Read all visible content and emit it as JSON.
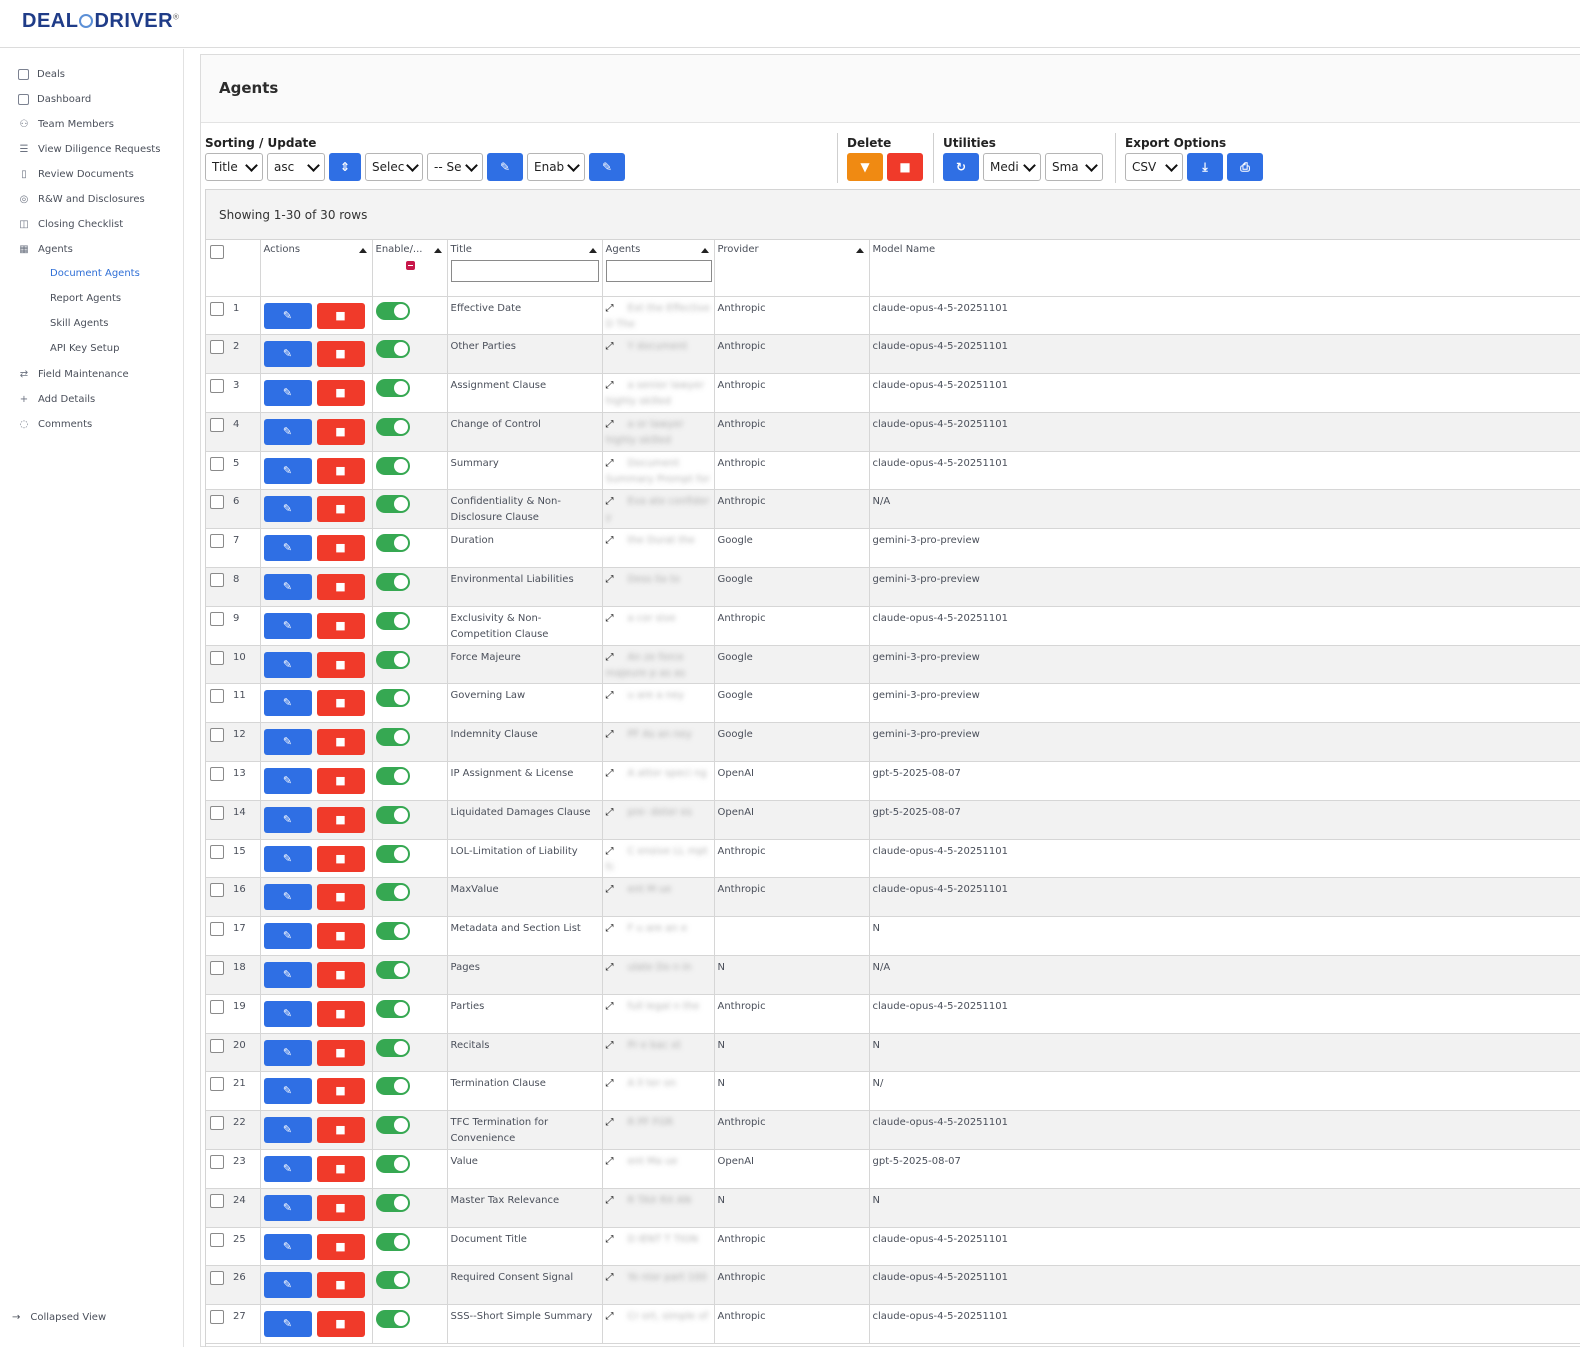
{
  "brand": {
    "name_left": "DEAL",
    "name_right": "DRIVER",
    "mark": "®"
  },
  "sidebar": {
    "items": [
      {
        "label": "Deals",
        "icon": "box-icon"
      },
      {
        "label": "Dashboard",
        "icon": "box-icon"
      },
      {
        "label": "Team Members",
        "icon": "users-icon"
      },
      {
        "label": "View Diligence Requests",
        "icon": "list-icon"
      },
      {
        "label": "Review Documents",
        "icon": "clipboard-icon"
      },
      {
        "label": "R&W and Disclosures",
        "icon": "check-circle-icon"
      },
      {
        "label": "Closing Checklist",
        "icon": "columns-icon"
      },
      {
        "label": "Agents",
        "icon": "table-icon"
      }
    ],
    "subitems": [
      "Document Agents",
      "Report Agents",
      "Skill Agents",
      "API Key Setup"
    ],
    "items_after": [
      {
        "label": "Field Maintenance",
        "icon": "route-icon"
      },
      {
        "label": "Add Details",
        "icon": "plus-icon"
      },
      {
        "label": "Comments",
        "icon": "comment-icon"
      }
    ],
    "collapsed_label": "Collapsed View"
  },
  "page": {
    "title": "Agents"
  },
  "toolbar": {
    "sorting_title": "Sorting / Update",
    "sort_field": "Title",
    "sort_order": "asc",
    "select_field": "Selec",
    "select_value": "-- Se",
    "enable_select": "Enab",
    "delete_title": "Delete",
    "utilities_title": "Utilities",
    "util_size": "Medi",
    "util_density": "Sma",
    "export_title": "Export Options",
    "export_format": "CSV"
  },
  "table": {
    "showing": "Showing 1-30 of 30 rows",
    "columns": [
      "Actions",
      "Enable/...",
      "Title",
      "Agents",
      "Provider",
      "Model Name"
    ],
    "rows": [
      {
        "n": "1",
        "title": "Effective Date",
        "agent": "Ext  the Effective D  The",
        "provider": "Anthropic",
        "model": "claude-opus-4-5-20251101"
      },
      {
        "n": "2",
        "title": "Other Parties",
        "agent": "Y document",
        "provider": "Anthropic",
        "model": "claude-opus-4-5-20251101"
      },
      {
        "n": "3",
        "title": "Assignment Clause",
        "agent": "a senior lawyer highly skilled",
        "provider": "Anthropic",
        "model": "claude-opus-4-5-20251101"
      },
      {
        "n": "4",
        "title": "Change of Control",
        "agent": "a or lawyer highly skilled",
        "provider": "Anthropic",
        "model": "claude-opus-4-5-20251101"
      },
      {
        "n": "5",
        "title": "Summary",
        "agent": "Document Summary Prompt for",
        "provider": "Anthropic",
        "model": "claude-opus-4-5-20251101"
      },
      {
        "n": "6",
        "title": "Confidentiality & Non-Disclosure Clause",
        "agent": "Eva ate confider y",
        "provider": "Anthropic",
        "model": "N/A"
      },
      {
        "n": "7",
        "title": "Duration",
        "agent": "the Durat the",
        "provider": "Google",
        "model": "gemini-3-pro-preview"
      },
      {
        "n": "8",
        "title": "Environmental Liabilities",
        "agent": "Dess lia to",
        "provider": "Google",
        "model": "gemini-3-pro-preview"
      },
      {
        "n": "9",
        "title": "Exclusivity & Non-Competition Clause",
        "agent": "a cor sive",
        "provider": "Anthropic",
        "model": "claude-opus-4-5-20251101"
      },
      {
        "n": "10",
        "title": "Force Majeure",
        "agent": "An ze force majeure p as as",
        "provider": "Google",
        "model": "gemini-3-pro-preview"
      },
      {
        "n": "11",
        "title": "Governing Law",
        "agent": "u are a ney",
        "provider": "Google",
        "model": "gemini-3-pro-preview"
      },
      {
        "n": "12",
        "title": "Indemnity Clause",
        "agent": "PF As an ney",
        "provider": "Google",
        "model": "gemini-3-pro-preview"
      },
      {
        "n": "13",
        "title": "IP Assignment & License",
        "agent": "A attor speci ng",
        "provider": "OpenAI",
        "model": "gpt-5-2025-08-07"
      },
      {
        "n": "14",
        "title": "Liquidated Damages Clause",
        "agent": "pre- deter es",
        "provider": "OpenAI",
        "model": "gpt-5-2025-08-07"
      },
      {
        "n": "15",
        "title": "LOL-Limitation of Liability",
        "agent": "C ensive LL mpt fc",
        "provider": "Anthropic",
        "model": "claude-opus-4-5-20251101"
      },
      {
        "n": "16",
        "title": "MaxValue",
        "agent": "ent M ue",
        "provider": "Anthropic",
        "model": "claude-opus-4-5-20251101"
      },
      {
        "n": "17",
        "title": "Metadata and Section List",
        "agent": "F u are an e",
        "provider": "",
        "model": "N"
      },
      {
        "n": "18",
        "title": "Pages",
        "agent": "ulate Do n in",
        "provider": "N",
        "model": "N/A"
      },
      {
        "n": "19",
        "title": "Parties",
        "agent": "full legal n the",
        "provider": "Anthropic",
        "model": "claude-opus-4-5-20251101"
      },
      {
        "n": "20",
        "title": "Recitals",
        "agent": "Pr e bac xt",
        "provider": "N",
        "model": "N"
      },
      {
        "n": "21",
        "title": "Termination Clause",
        "agent": "A ll ter on",
        "provider": "N",
        "model": "N/"
      },
      {
        "n": "22",
        "title": "TFC Termination for Convenience",
        "agent": "R PF FOR",
        "provider": "Anthropic",
        "model": "claude-opus-4-5-20251101"
      },
      {
        "n": "23",
        "title": "Value",
        "agent": "ent Ma ue",
        "provider": "OpenAI",
        "model": "gpt-5-2025-08-07"
      },
      {
        "n": "24",
        "title": "Master Tax Relevance",
        "agent": "R TAX RX AN",
        "provider": "N",
        "model": "N"
      },
      {
        "n": "25",
        "title": "Document Title",
        "agent": "D IENT T TION",
        "provider": "Anthropic",
        "model": "claude-opus-4-5-20251101"
      },
      {
        "n": "26",
        "title": "Required Consent Signal",
        "agent": "Yo nior part 100",
        "provider": "Anthropic",
        "model": "claude-opus-4-5-20251101"
      },
      {
        "n": "27",
        "title": "SSS--Short Simple Summary",
        "agent": "Cr ort, simple of",
        "provider": "Anthropic",
        "model": "claude-opus-4-5-20251101"
      }
    ]
  },
  "colors": {
    "primary": "#2f6fe4",
    "danger": "#f03a2a",
    "warning": "#f08a12",
    "success": "#36a852",
    "brand": "#1f3c88"
  }
}
